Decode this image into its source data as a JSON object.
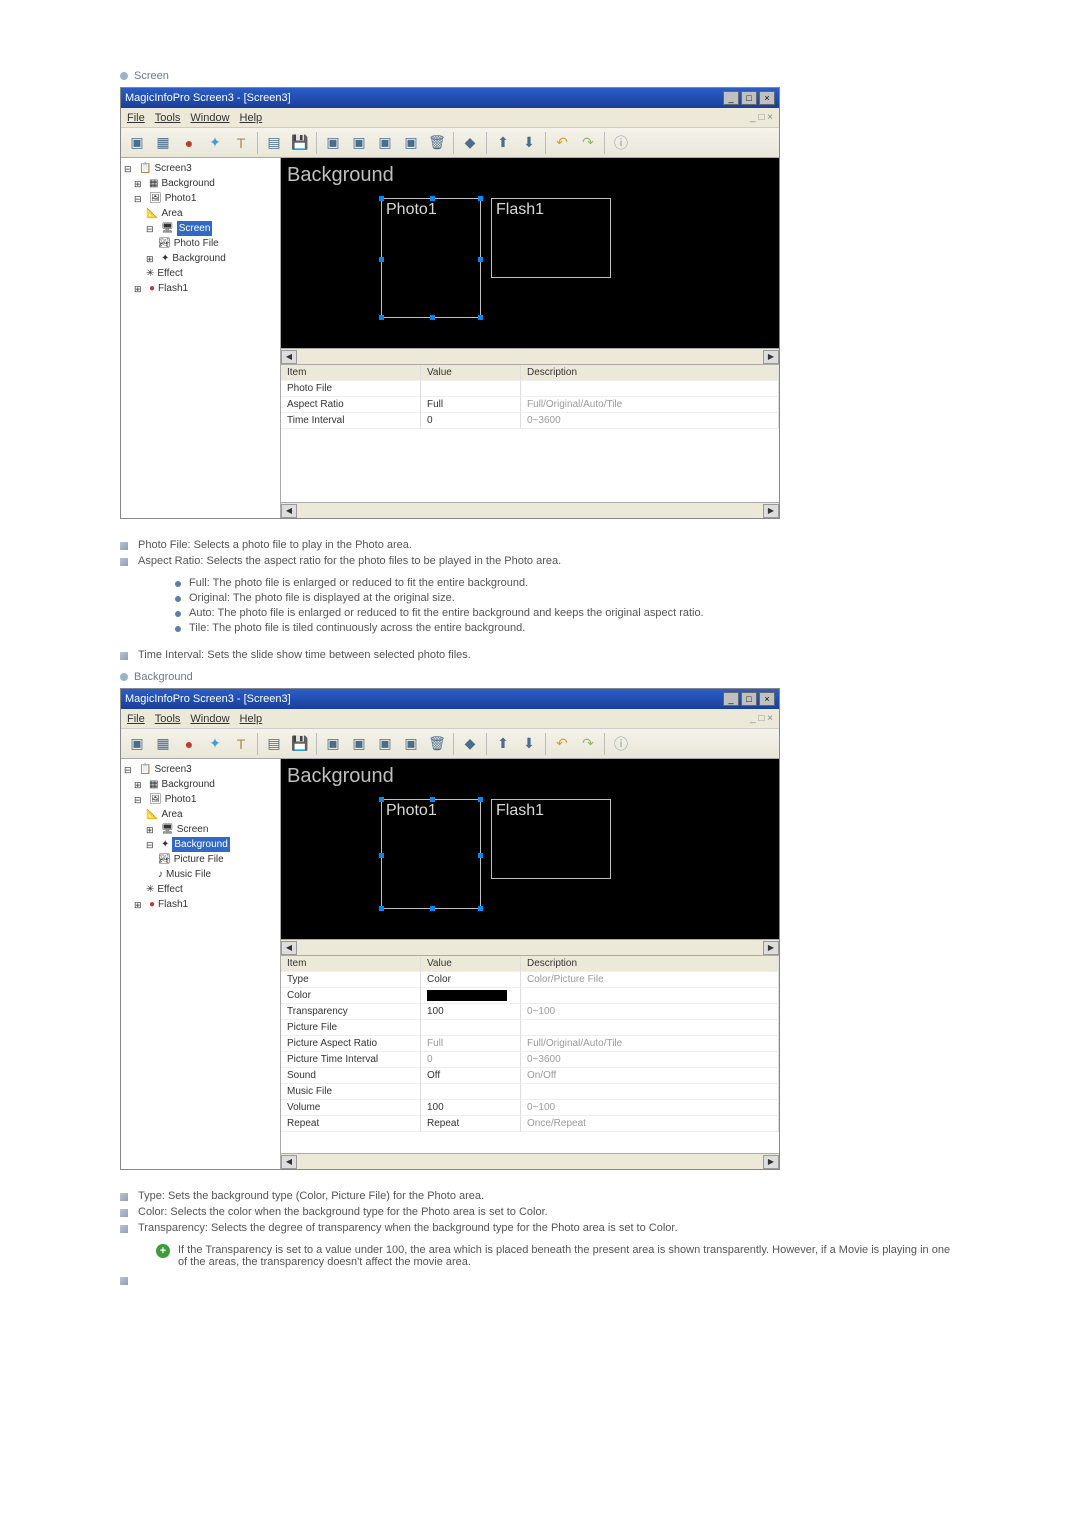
{
  "section1": {
    "title": "Screen"
  },
  "section2": {
    "title": "Background"
  },
  "app": {
    "title": "MagicInfoPro Screen3 - [Screen3]",
    "menu": {
      "file": "File",
      "tools": "Tools",
      "window": "Window",
      "help": "Help"
    }
  },
  "tree_screen": {
    "n0": "Screen3",
    "n1": "Background",
    "n2": "Photo1",
    "n3": "Area",
    "n4": "Screen",
    "n5": "Photo File",
    "n6": "Background",
    "n7": "Effect",
    "n8": "Flash1"
  },
  "tree_bg": {
    "n0": "Screen3",
    "n1": "Background",
    "n2": "Photo1",
    "n3": "Area",
    "n4": "Screen",
    "n5": "Background",
    "n6": "Picture File",
    "n7": "Music File",
    "n8": "Effect",
    "n9": "Flash1"
  },
  "canvas": {
    "bg_label": "Background",
    "tile_photo": "Photo1",
    "tile_flash": "Flash1"
  },
  "grid_header": {
    "item": "Item",
    "value": "Value",
    "desc": "Description"
  },
  "props_screen": [
    {
      "item": "Photo File",
      "value": "",
      "desc": ""
    },
    {
      "item": "Aspect Ratio",
      "value": "Full",
      "desc": "Full/Original/Auto/Tile"
    },
    {
      "item": "Time Interval",
      "value": "0",
      "desc": "0~3600"
    }
  ],
  "props_bg": [
    {
      "item": "Type",
      "value": "Color",
      "desc": "Color/Picture File"
    },
    {
      "item": "Color",
      "value": "",
      "desc": ""
    },
    {
      "item": "Transparency",
      "value": "100",
      "desc": "0~100"
    },
    {
      "item": "Picture File",
      "value": "",
      "desc": ""
    },
    {
      "item": "Picture Aspect Ratio",
      "value": "Full",
      "desc": "Full/Original/Auto/Tile"
    },
    {
      "item": "Picture Time Interval",
      "value": "0",
      "desc": "0~3600"
    },
    {
      "item": "Sound",
      "value": "Off",
      "desc": "On/Off"
    },
    {
      "item": "Music File",
      "value": "",
      "desc": ""
    },
    {
      "item": "Volume",
      "value": "100",
      "desc": "0~100"
    },
    {
      "item": "Repeat",
      "value": "Repeat",
      "desc": "Once/Repeat"
    }
  ],
  "doc1": {
    "li1": "Photo File: Selects a photo file to play in the Photo area.",
    "li2": "Aspect Ratio: Selects the aspect ratio for the photo files to be played in the Photo area.",
    "sub": {
      "a": "Full: The photo file is enlarged or reduced to fit the entire background.",
      "b": "Original: The photo file is displayed at the original size.",
      "c": "Auto: The photo file is enlarged or reduced to fit the entire background and keeps the original aspect ratio.",
      "d": "Tile: The photo file is tiled continuously across the entire background."
    },
    "li3": "Time Interval: Sets the slide show time between selected photo files."
  },
  "doc2": {
    "li1": "Type: Sets the background type (Color, Picture File) for the Photo area.",
    "li2": "Color: Selects the color when the background type for the Photo area is set to Color.",
    "li3": "Transparency: Selects the degree of transparency when the background type for the Photo area is set to Color.",
    "note": "If the Transparency is set to a value under 100, the area which is placed beneath the present area is shown transparently. However, if a Movie is playing in one of the areas, the transparency doesn't affect the movie area."
  }
}
